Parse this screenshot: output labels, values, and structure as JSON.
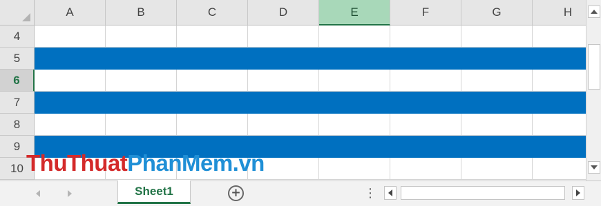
{
  "spreadsheet": {
    "columns": [
      "A",
      "B",
      "C",
      "D",
      "E",
      "F",
      "G",
      "H"
    ],
    "selected_column": "E",
    "rows": [
      {
        "label": "4",
        "filled": false
      },
      {
        "label": "5",
        "filled": true
      },
      {
        "label": "6",
        "filled": false
      },
      {
        "label": "7",
        "filled": true
      },
      {
        "label": "8",
        "filled": false
      },
      {
        "label": "9",
        "filled": true
      },
      {
        "label": "10",
        "filled": false
      }
    ],
    "selected_row": "6",
    "fill_color": "#0070c0",
    "header_select_color": "#217346"
  },
  "watermark": {
    "part1": "ThuThuat",
    "part2": "PhanMem.vn"
  },
  "tabbar": {
    "sheet_tab_label": "Sheet1",
    "add_sheet_symbol": "+",
    "more_symbol": "⋮"
  },
  "icons": {
    "nav_prev": "triangle-left-icon",
    "nav_next": "triangle-right-icon",
    "scroll_up": "arrow-up-icon",
    "scroll_down": "arrow-down-icon",
    "scroll_left": "arrow-left-icon",
    "scroll_right": "arrow-right-icon",
    "add_sheet": "plus-circle-icon"
  }
}
